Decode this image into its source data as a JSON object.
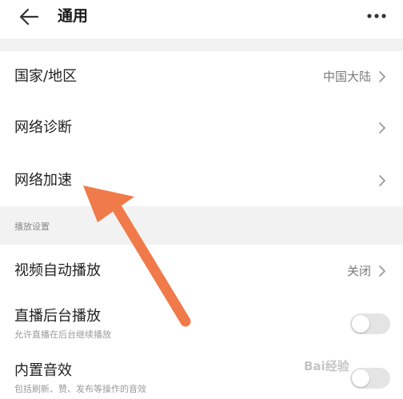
{
  "header": {
    "title": "通用",
    "back_icon": "arrow-left-icon",
    "more_icon": "more-horizontal-icon"
  },
  "rows": {
    "region": {
      "label": "国家/地区",
      "value": "中国大陆"
    },
    "network_diagnosis": {
      "label": "网络诊断"
    },
    "network_acceleration": {
      "label": "网络加速"
    }
  },
  "playback_section": {
    "title": "播放设置",
    "autoplay": {
      "label": "视频自动播放",
      "value": "关闭"
    },
    "background_live": {
      "label": "直播后台播放",
      "sub": "允许直播在后台继续播放",
      "enabled": false
    },
    "builtin_sound": {
      "label": "内置音效",
      "sub": "包括刷新、赞、发布等操作的音效",
      "enabled": false
    }
  },
  "annotation": {
    "color": "#f07a4a"
  },
  "watermark": {
    "text": "Bai经验"
  },
  "colors": {
    "background": "#ffffff",
    "section_gap": "#f2f2f2",
    "secondary_text": "#7a7a7a",
    "toggle_off": "#e4e4e4"
  }
}
